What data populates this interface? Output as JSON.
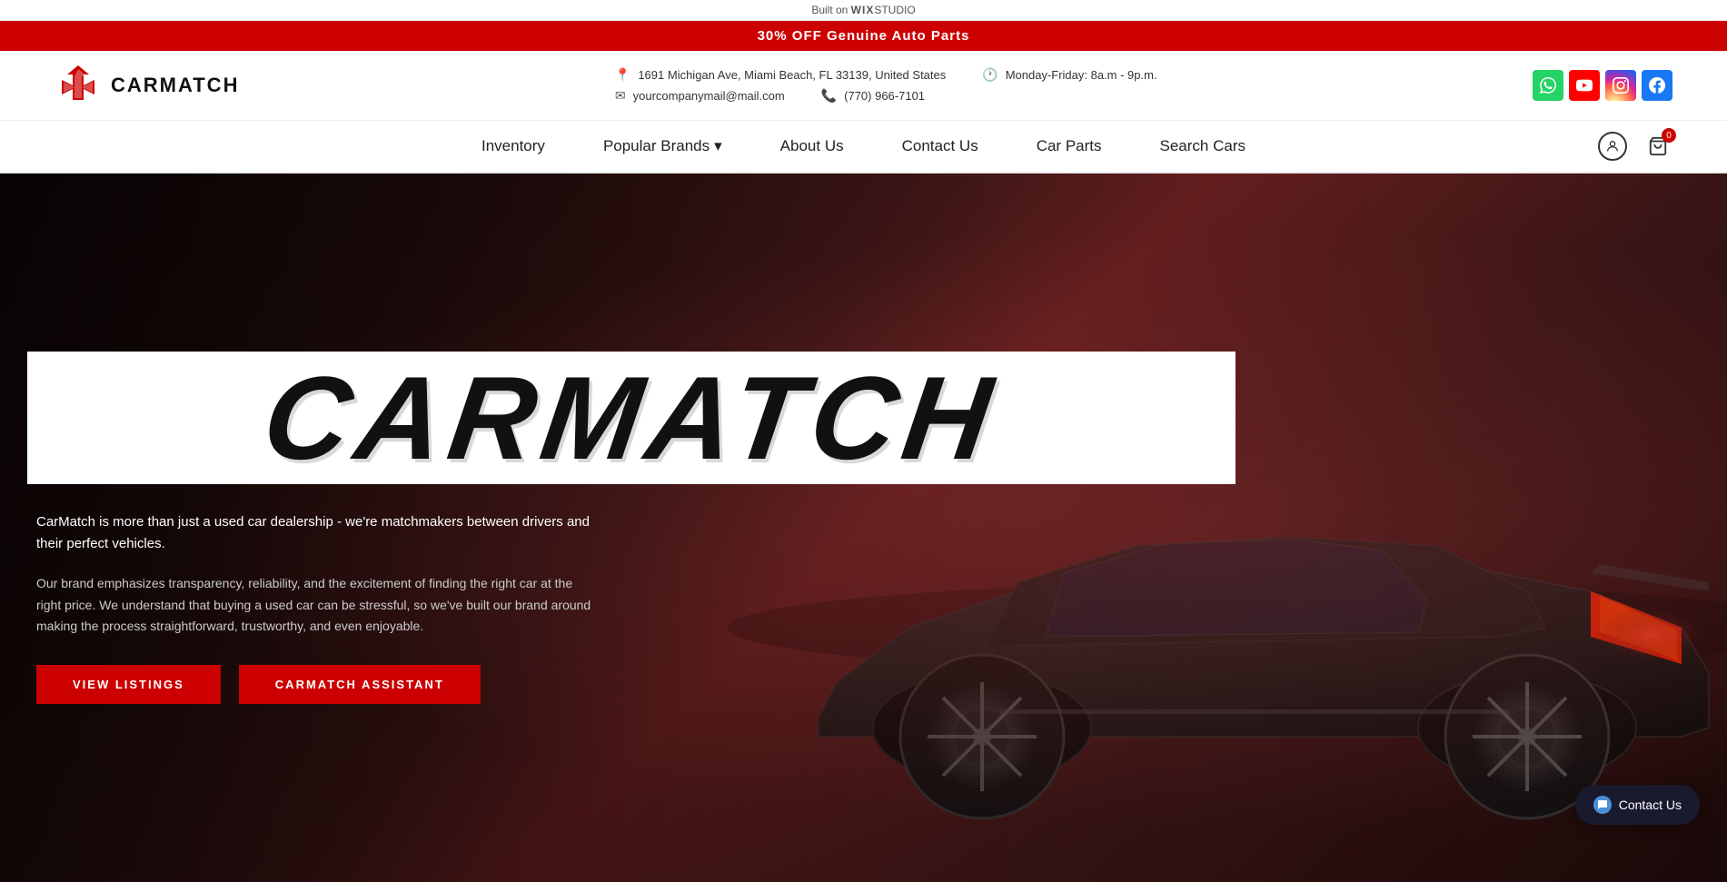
{
  "wixbar": {
    "prefix": "Built on ",
    "brand": "WIX",
    "suffix": "STUDIO"
  },
  "promobar": {
    "text": "30% OFF Genuine Auto Parts"
  },
  "header": {
    "logo_text": "CARMATCH",
    "address": "1691 Michigan Ave, Miami Beach, FL 33139, United States",
    "email": "yourcompanymail@mail.com",
    "hours": "Monday-Friday: 8a.m - 9p.m.",
    "phone": "(770) 966-7101"
  },
  "nav": {
    "items": [
      {
        "label": "Inventory"
      },
      {
        "label": "Popular Brands",
        "has_dropdown": true
      },
      {
        "label": "About Us"
      },
      {
        "label": "Contact Us"
      },
      {
        "label": "Car Parts"
      },
      {
        "label": "Search Cars"
      }
    ],
    "cart_count": "0"
  },
  "hero": {
    "brand_name": "CARMATCH",
    "paragraph1": "CarMatch is more than just a used car dealership - we're matchmakers between drivers and their perfect vehicles.",
    "paragraph2": "Our brand emphasizes transparency, reliability, and the excitement of finding the right car at the right price. We understand that buying a used car can be stressful, so we've built our brand around making the process straightforward, trustworthy, and even enjoyable.",
    "btn_listings": "VIEW LISTINGS",
    "btn_assistant": "CARMATCH ASSISTANT"
  },
  "contact_float": {
    "label": "Contact Us"
  }
}
